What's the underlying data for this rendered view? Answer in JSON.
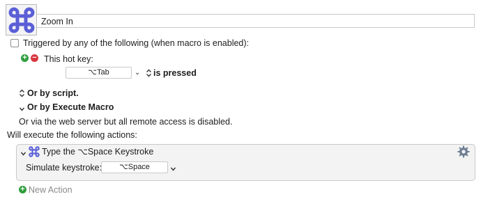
{
  "macro": {
    "icon": "cmd-key-icon",
    "name": "Zoom In"
  },
  "trigger": {
    "checkbox_label": "Triggered by any of the following (when macro is enabled):",
    "hotkey_label": "This hot key:",
    "hotkey_value": "⌥Tab",
    "hotkey_condition": "is pressed",
    "by_script": "Or by script.",
    "by_execute_macro": "Or by Execute Macro",
    "web_server_note": "Or via the web server but all remote access is disabled."
  },
  "actions": {
    "header": "Will execute the following actions:",
    "items": [
      {
        "title": "Type the ⌥Space Keystroke",
        "field_label": "Simulate keystroke:",
        "field_value": "⌥Space"
      }
    ],
    "new_action_label": "New Action"
  },
  "colors": {
    "add": "#2f9e3e",
    "remove": "#d9363e",
    "icon_accent": "#5b5fd6"
  }
}
